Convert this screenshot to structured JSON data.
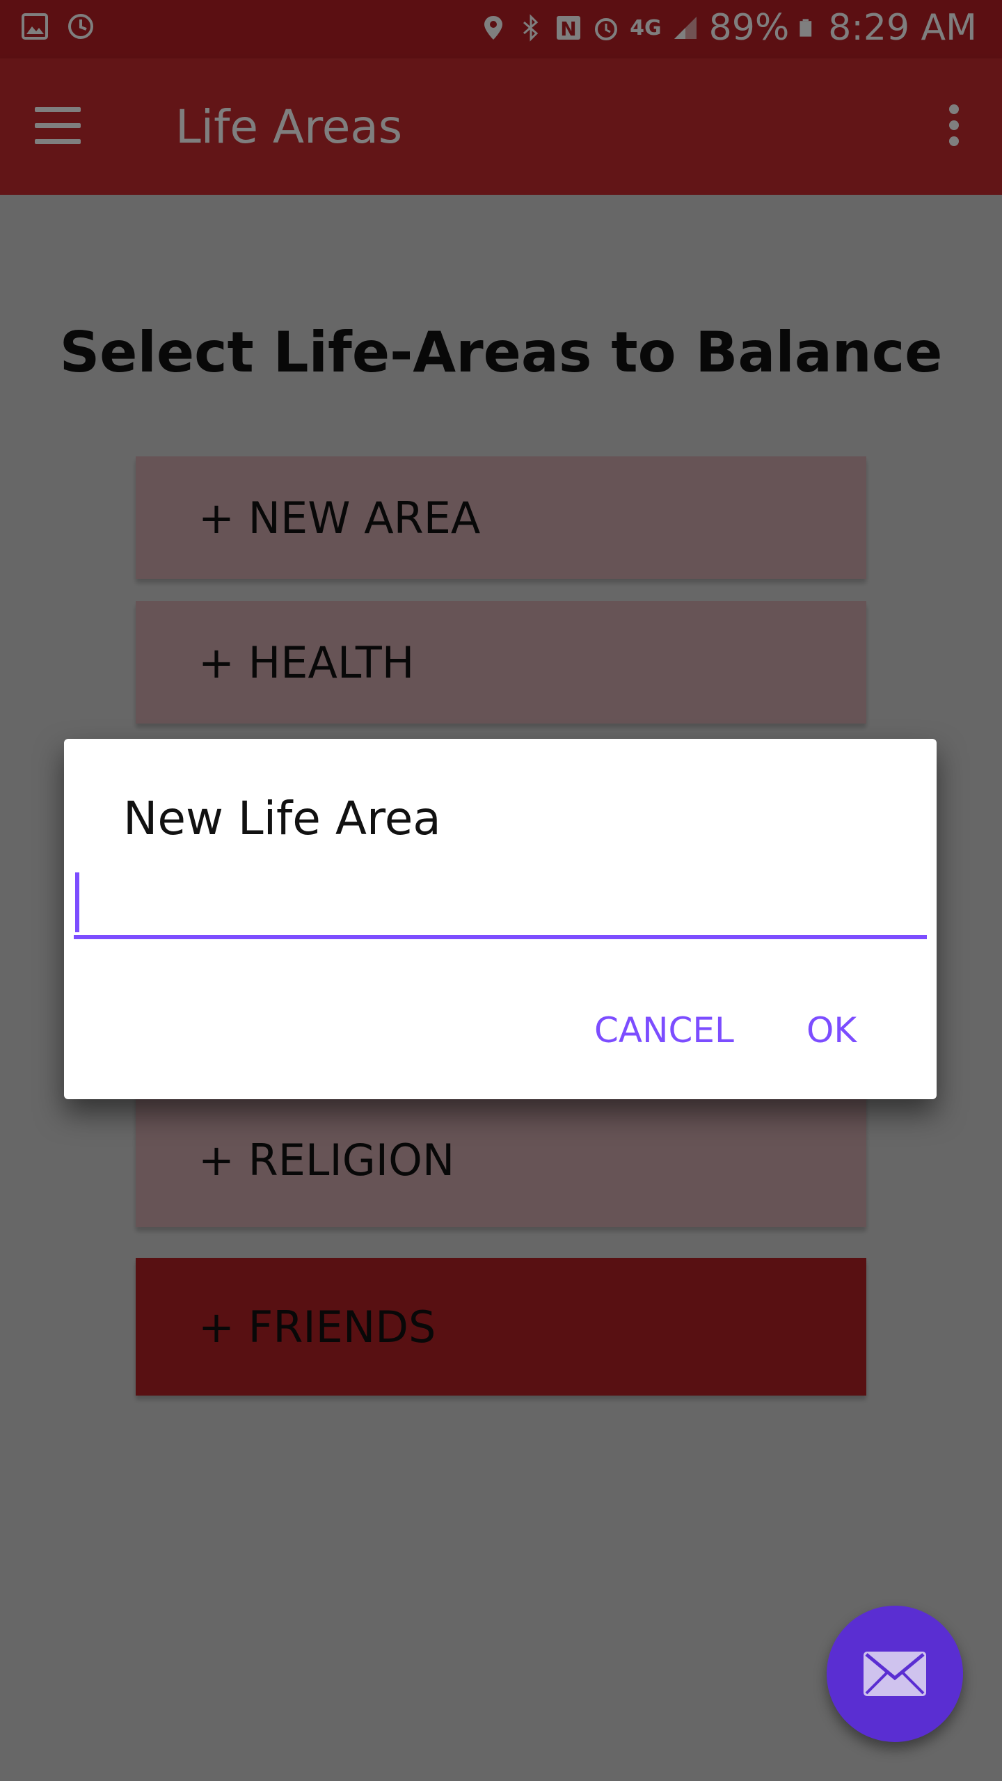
{
  "status_bar": {
    "battery": "89%",
    "time": "8:29 AM",
    "network": "4G"
  },
  "app_bar": {
    "title": "Life Areas"
  },
  "main": {
    "heading": "Select Life-Areas to Balance",
    "areas": [
      {
        "label": "+ NEW AREA"
      },
      {
        "label": "+ HEALTH"
      },
      {
        "label": "+ RELIGION"
      },
      {
        "label": "+ FRIENDS",
        "selected": true
      }
    ]
  },
  "dialog": {
    "title": "New Life Area",
    "input_value": "",
    "cancel_label": "CANCEL",
    "ok_label": "OK"
  },
  "colors": {
    "status_bar": "#b61f25",
    "app_bar": "#c52a2f",
    "accent": "#7c4dff",
    "fab": "#5a2ed2",
    "area_bg": "#cfa9ad",
    "area_selected": "#b12024"
  },
  "icons": {
    "fab": "mail-icon",
    "menu": "menu-icon",
    "overflow": "overflow-icon"
  }
}
